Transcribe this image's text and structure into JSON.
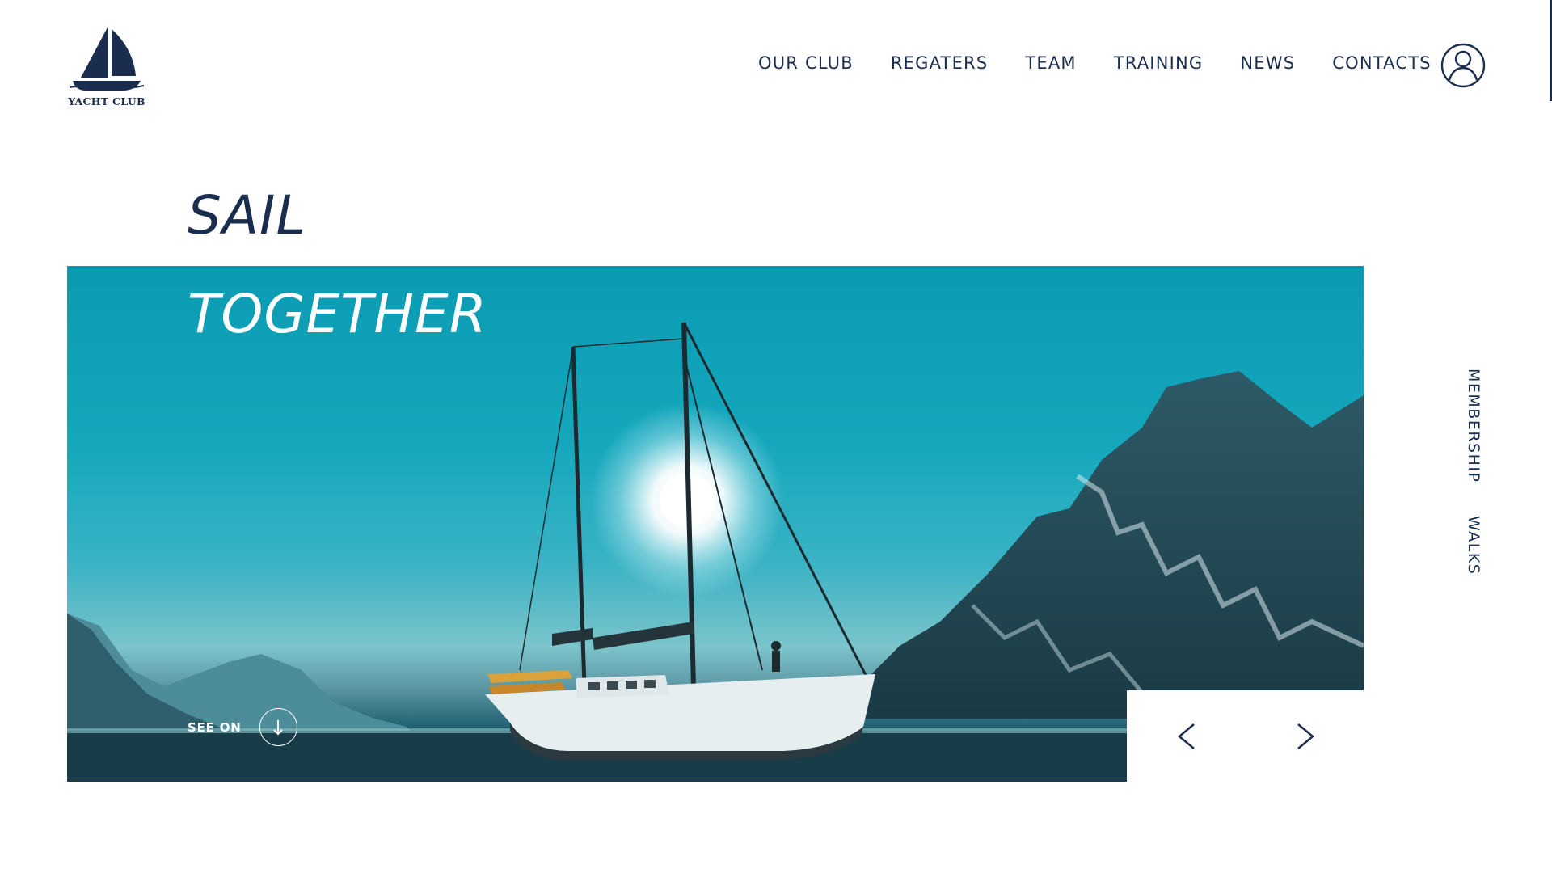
{
  "brand": {
    "logo_text": "YACHT CLUB",
    "logo_icon": "sailboat-icon"
  },
  "nav": {
    "items": [
      {
        "label": "OUR CLUB"
      },
      {
        "label": "REGATERS"
      },
      {
        "label": "TEAM"
      },
      {
        "label": "TRAINING"
      },
      {
        "label": "NEWS"
      },
      {
        "label": "CONTACTS"
      }
    ],
    "user_icon": "user-icon"
  },
  "hero": {
    "line1": "SAIL",
    "line2": "TOGETHER",
    "see_on_label": "SEE ON",
    "see_on_icon": "arrow-down-icon",
    "prev_icon": "chevron-left-icon",
    "next_icon": "chevron-right-icon"
  },
  "side_links": {
    "membership": "MEMBERSHIP",
    "walks": "WALKS"
  },
  "colors": {
    "primary": "#1b2d4f",
    "background": "#ffffff",
    "sky": "#15a8bd"
  }
}
